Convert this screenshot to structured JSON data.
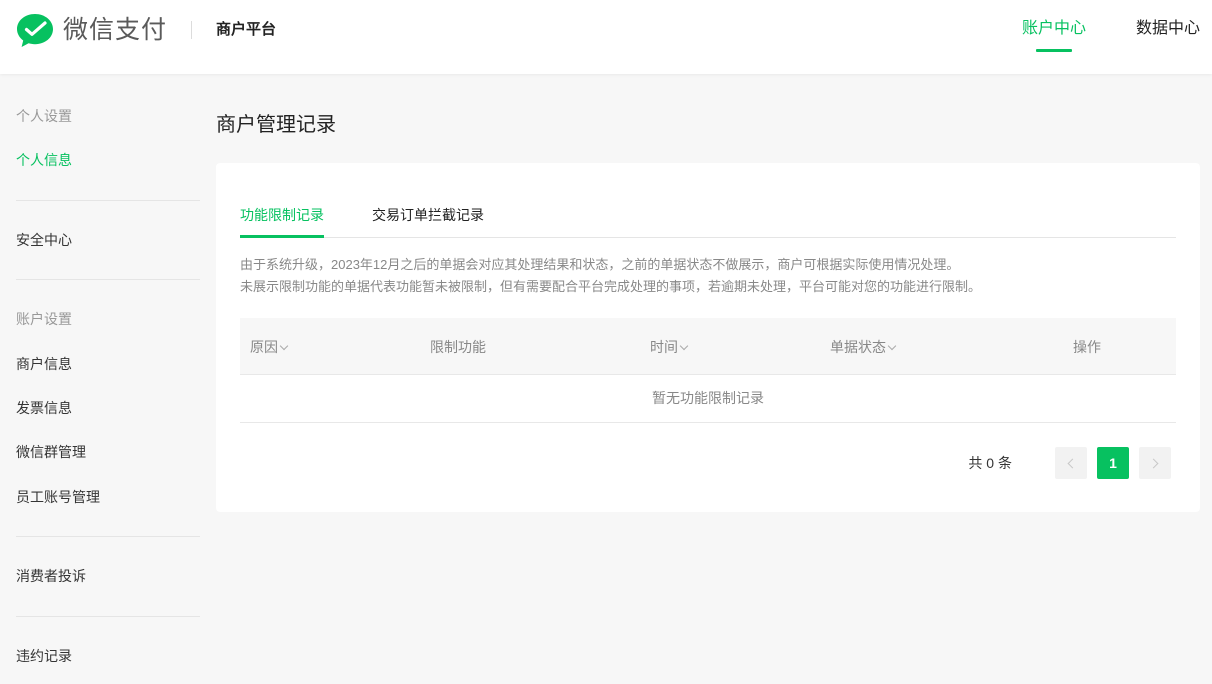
{
  "header": {
    "brand": "微信支付",
    "platform": "商户平台",
    "nav": [
      {
        "label": "账户中心",
        "active": true
      },
      {
        "label": "数据中心",
        "active": false
      }
    ]
  },
  "sidebar": {
    "groups": [
      {
        "title": "个人设置",
        "items": [
          "个人信息"
        ]
      },
      {
        "title": "",
        "items": [
          "安全中心"
        ]
      },
      {
        "title": "账户设置",
        "items": [
          "商户信息",
          "发票信息",
          "微信群管理",
          "员工账号管理"
        ]
      },
      {
        "title": "",
        "items": [
          "消费者投诉"
        ]
      },
      {
        "title": "",
        "items": [
          "违约记录"
        ]
      }
    ],
    "active_item": "个人信息"
  },
  "main": {
    "title": "商户管理记录",
    "tabs": [
      {
        "label": "功能限制记录",
        "active": true
      },
      {
        "label": "交易订单拦截记录",
        "active": false
      }
    ],
    "notice": [
      "由于系统升级，2023年12月之后的单据会对应其处理结果和状态，之前的单据状态不做展示，商户可根据实际使用情况处理。",
      "未展示限制功能的单据代表功能暂未被限制，但有需要配合平台完成处理的事项，若逾期未处理，平台可能对您的功能进行限制。"
    ],
    "table": {
      "columns": [
        {
          "label": "原因",
          "sortable": true
        },
        {
          "label": "限制功能",
          "sortable": false
        },
        {
          "label": "时间",
          "sortable": true
        },
        {
          "label": "单据状态",
          "sortable": true
        },
        {
          "label": "操作",
          "sortable": false
        }
      ],
      "empty_text": "暂无功能限制记录"
    },
    "pagination": {
      "total_text": "共 0 条",
      "current_page": "1"
    }
  },
  "colors": {
    "accent": "#07c160",
    "background": "#f7f7f7"
  }
}
